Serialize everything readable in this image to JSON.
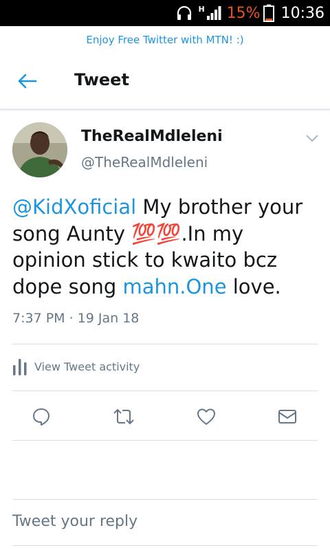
{
  "status_bar": {
    "network_type": "H",
    "battery_percent": "15%",
    "time": "10:36",
    "icons": [
      "headset-icon",
      "signal-icon",
      "battery-icon"
    ],
    "battery_color": "#e8541f"
  },
  "promo": {
    "text": "Enjoy Free Twitter with MTN! :)"
  },
  "header": {
    "title": "Tweet",
    "back_icon": "arrow-left-icon"
  },
  "tweet": {
    "display_name": "TheRealMdleleni",
    "username": "@TheRealMdleleni",
    "text": {
      "mention": "@KidXoficial",
      "part1": " My brother your song Aunty ",
      "emoji": "💯💯",
      "part2": ".In my opinion stick to kwaito bcz dope song ",
      "link": "mahn.One",
      "part3": " love."
    },
    "timestamp": "7:37 PM · 19 Jan 18",
    "activity_label": "View Tweet activity"
  },
  "actions": [
    "reply-icon",
    "retweet-icon",
    "like-icon",
    "message-icon"
  ],
  "reply": {
    "placeholder": "Tweet your reply"
  },
  "colors": {
    "accent": "#1b95e0",
    "secondary_text": "#657786",
    "divider": "#d8dee2"
  }
}
